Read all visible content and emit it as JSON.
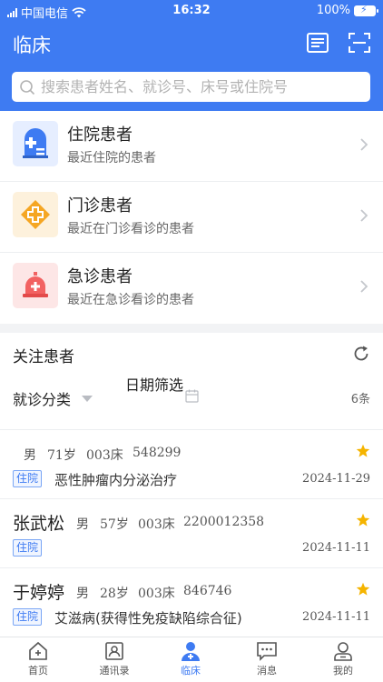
{
  "status_bar": {
    "carrier": "中国电信",
    "time": "16:32",
    "battery": "100%"
  },
  "header": {
    "title": "临床",
    "icons": [
      "list-icon",
      "scan-icon"
    ]
  },
  "search": {
    "placeholder": "搜索患者姓名、就诊号、床号或住院号"
  },
  "categories": [
    {
      "title": "住院患者",
      "subtitle": "最近住院的患者",
      "icon": "hospital-icon",
      "color": "#3e7bf2"
    },
    {
      "title": "门诊患者",
      "subtitle": "最近在门诊看诊的患者",
      "icon": "clinic-cross-icon",
      "color": "#f5a623"
    },
    {
      "title": "急诊患者",
      "subtitle": "最近在急诊看诊的患者",
      "icon": "emergency-bell-icon",
      "color": "#f26161"
    }
  ],
  "follow": {
    "title": "关注患者",
    "filter_category": "就诊分类",
    "filter_date": "日期筛选",
    "count": "6条",
    "patients": [
      {
        "name": "",
        "gender": "男",
        "age": "71岁",
        "bed": "003床",
        "id": "548299",
        "tag": "住院",
        "diagnosis": "恶性肿瘤内分泌治疗",
        "date": "2024-11-29"
      },
      {
        "name": "张武松",
        "gender": "男",
        "age": "57岁",
        "bed": "003床",
        "id": "2200012358",
        "tag": "住院",
        "diagnosis": "",
        "date": "2024-11-11"
      },
      {
        "name": "于婷婷",
        "gender": "男",
        "age": "28岁",
        "bed": "003床",
        "id": "846746",
        "tag": "住院",
        "diagnosis": "艾滋病(获得性免疫缺陷综合征)",
        "date": "2024-11-11"
      }
    ]
  },
  "tabbar": {
    "tabs": [
      {
        "label": "首页",
        "icon": "home-icon",
        "active": false
      },
      {
        "label": "通讯录",
        "icon": "contacts-icon",
        "active": false
      },
      {
        "label": "临床",
        "icon": "clinical-icon",
        "active": true
      },
      {
        "label": "消息",
        "icon": "message-icon",
        "active": false
      },
      {
        "label": "我的",
        "icon": "profile-icon",
        "active": false
      }
    ]
  },
  "colors": {
    "primary": "#3e7bf2",
    "star": "#f5b400"
  }
}
